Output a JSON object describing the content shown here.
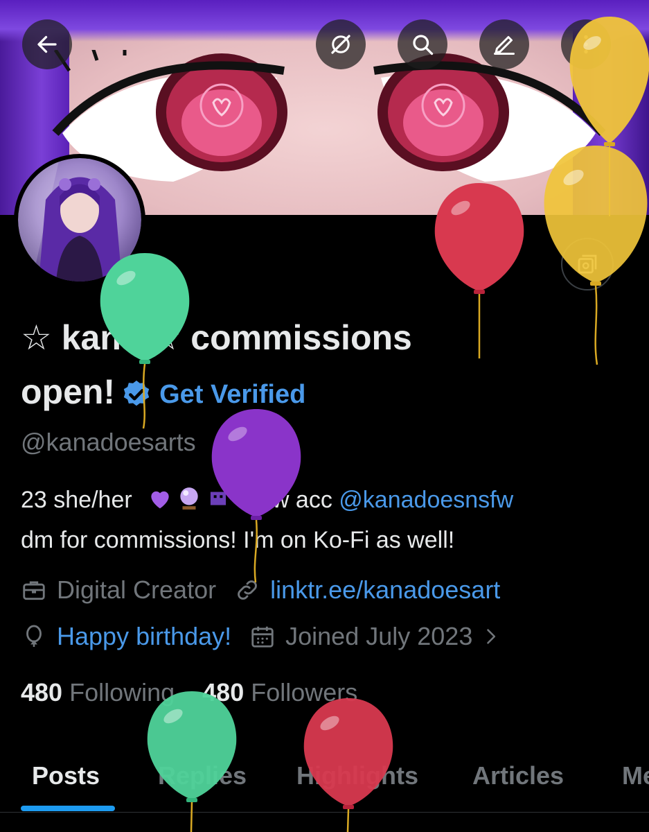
{
  "nav": {
    "back_icon": "arrow-left-icon",
    "grok_icon": "grok-icon",
    "search_icon": "search-icon",
    "edit_icon": "pen-icon",
    "more_icon": "more-vertical-icon"
  },
  "profile": {
    "name_line": "☆ kana ☆ commissions open!",
    "get_verified": "Get Verified",
    "handle": "@kanadoesarts",
    "bio_line1_prefix": "23 she/her",
    "bio_line1_mid": "nsfw acc",
    "bio_line1_link": "@kanadoesnsfw",
    "bio_line2": "dm for commissions! I'm on Ko-Fi as well!",
    "category": "Digital Creator",
    "website": "linktr.ee/kanadoesart",
    "birthday": "Happy birthday!",
    "joined": "Joined July 2023"
  },
  "stats": {
    "following_count": "480",
    "following_label": "Following",
    "followers_count": "480",
    "followers_label": "Followers"
  },
  "tabs": [
    "Posts",
    "Replies",
    "Highlights",
    "Articles",
    "Media"
  ],
  "active_tab": "Posts",
  "colors": {
    "background": "#000000",
    "link": "#4a99e9",
    "muted": "#71767b",
    "tab_indicator": "#1d9bf0",
    "balloon_green": "#4fd39a",
    "balloon_red": "#d8394f",
    "balloon_yellow": "#f0c43a",
    "balloon_purple": "#8a34c9"
  }
}
